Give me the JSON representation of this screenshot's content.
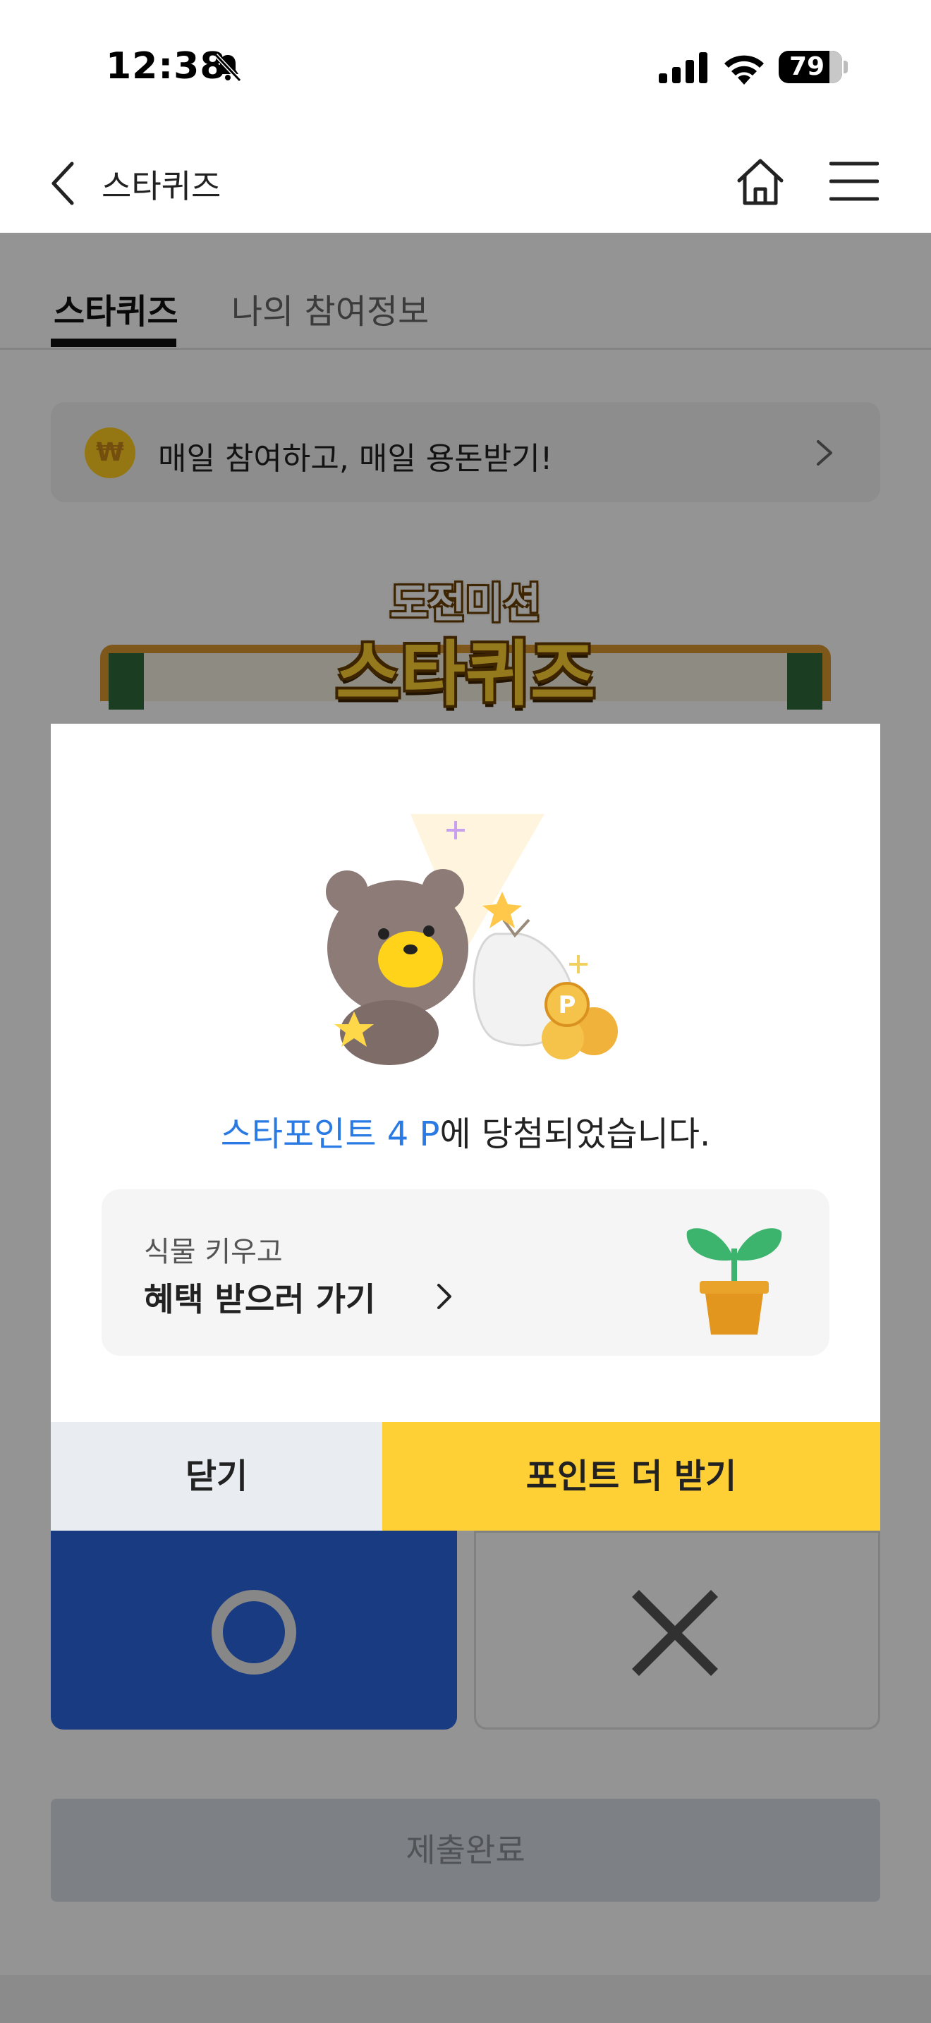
{
  "status_bar": {
    "time": "12:38",
    "battery": "79",
    "icons": [
      "bell-slash-icon",
      "signal-icon",
      "wifi-icon",
      "battery-icon"
    ]
  },
  "header": {
    "title": "스타퀴즈",
    "icons": [
      "back-chevron-icon",
      "home-icon",
      "hamburger-menu-icon"
    ]
  },
  "tabs": [
    {
      "label": "스타퀴즈",
      "active": true
    },
    {
      "label": "나의 참여정보",
      "active": false
    }
  ],
  "promo_banner": {
    "icon_glyph": "₩",
    "text": "매일 참여하고, 매일 용돈받기!"
  },
  "quiz_logo": {
    "subtitle": "도전미션",
    "title": "스타퀴즈"
  },
  "answers": {
    "o_symbol": "O",
    "x_symbol": "X"
  },
  "submit": {
    "label": "제출완료"
  },
  "modal": {
    "result_highlight": "스타포인트 4 P",
    "result_suffix": "에 당첨되었습니다.",
    "benefit": {
      "subtitle": "식물 키우고",
      "title": "혜택 받으러 가기"
    },
    "close_label": "닫기",
    "more_points_label": "포인트 더 받기"
  },
  "colors": {
    "accent_blue": "#2a7ae4",
    "answer_o_blue": "#2a66e0",
    "primary_yellow": "#ffd035",
    "close_gray": "#e9ecf0"
  }
}
